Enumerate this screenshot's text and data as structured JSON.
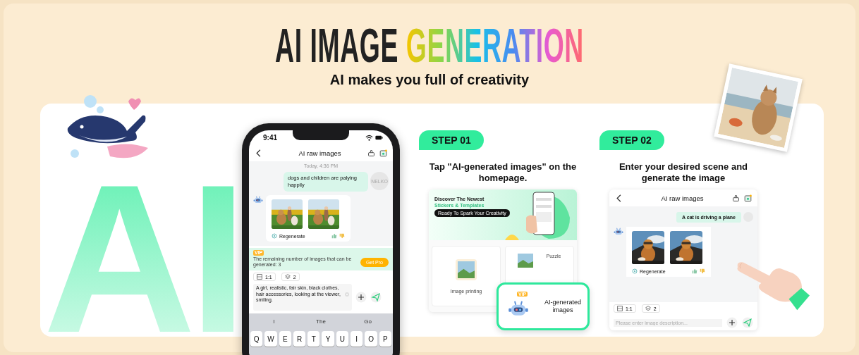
{
  "headline": {
    "plain": "AI IMAGE",
    "colorful": "GENERATION"
  },
  "tagline": "AI makes you full of creativity",
  "backdrop_letters": "AI",
  "phone": {
    "time": "9:41",
    "title": "AI raw images",
    "timestamp": "Today, 4:36 PM",
    "user_message": "dogs and children are palying happily",
    "user_avatar": "NELKO",
    "regenerate": "Regenerate",
    "quota": {
      "badge": "VIP",
      "text": "The remaining number of images that can be generated: 3",
      "button": "Get Pro"
    },
    "ratio": "1:1",
    "count": "2",
    "prompt": "A girl, realistic, fair skin, black clothes, hair accessories, looking at the viewer, smiling.",
    "suggestions": [
      "I",
      "The",
      "Go"
    ],
    "keys": [
      "Q",
      "W",
      "E",
      "R",
      "T",
      "Y",
      "U",
      "I",
      "O",
      "P"
    ]
  },
  "steps": [
    {
      "kind": "home",
      "label": "STEP 01",
      "instruction": "Tap \"AI-generated images\" on the homepage.",
      "banner": {
        "title": "Discover The Newest",
        "subtitle": "Stickers & Templates",
        "button": "Ready To Spark Your Creativity"
      },
      "tiles": [
        "Image printing",
        "Puzzle"
      ],
      "callout": {
        "badge": "VIP",
        "label": "AI-generated images"
      }
    },
    {
      "kind": "chat",
      "label": "STEP 02",
      "instruction": "Enter your desired scene and generate the image",
      "title": "AI raw images",
      "user_message": "A cat is driving a plane",
      "regenerate": "Regenerate",
      "ratio": "1:1",
      "count": "2",
      "placeholder": "Please enter image description..."
    }
  ]
}
